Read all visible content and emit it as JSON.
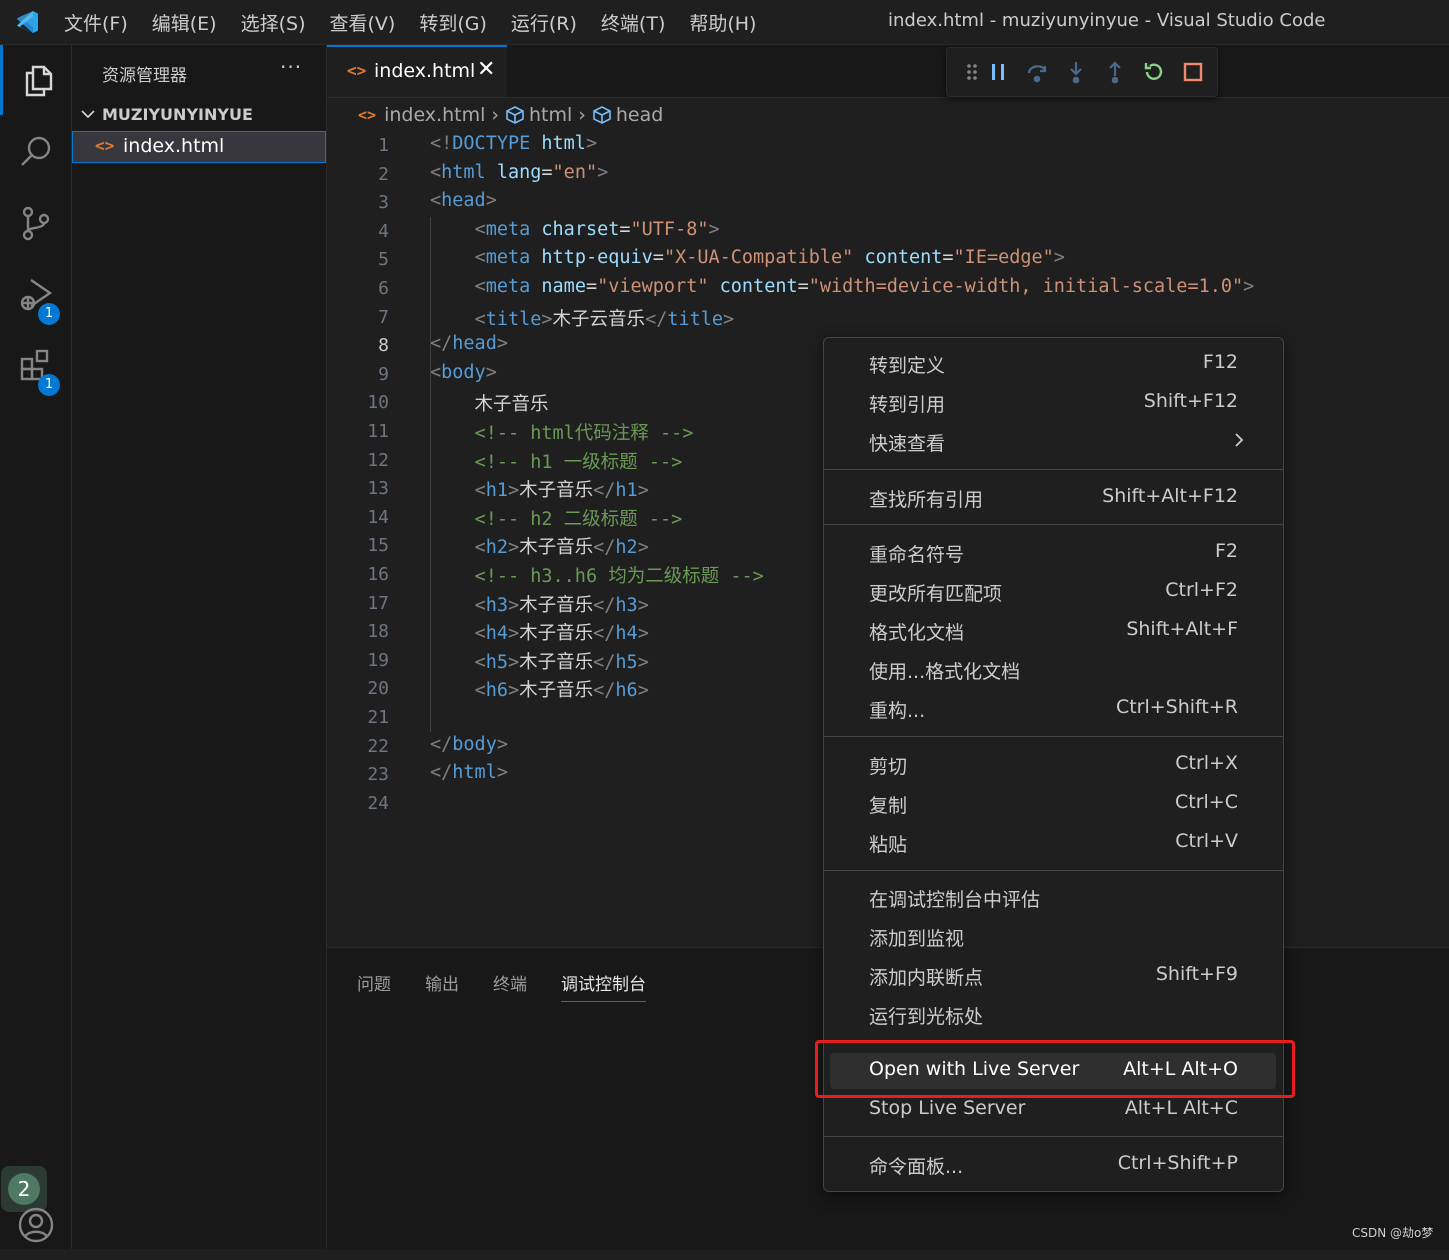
{
  "titlebar": {
    "menu": [
      "文件(F)",
      "编辑(E)",
      "选择(S)",
      "查看(V)",
      "转到(G)",
      "运行(R)",
      "终端(T)",
      "帮助(H)"
    ],
    "window_title": "index.html - muziyunyinyue - Visual Studio Code"
  },
  "activity_bar": {
    "items": [
      {
        "icon": "files-icon"
      },
      {
        "icon": "search-icon"
      },
      {
        "icon": "source-control-icon"
      },
      {
        "icon": "run-debug-icon",
        "badge": "1"
      },
      {
        "icon": "extensions-icon",
        "badge": "1"
      }
    ],
    "account_badge": "2"
  },
  "sidebar": {
    "title": "资源管理器",
    "more": "···",
    "folder": "MUZIYUNYINYUE",
    "files": [
      {
        "name": "index.html",
        "icon": "<>"
      }
    ]
  },
  "tabs": [
    {
      "label": "index.html",
      "icon": "<>",
      "close": "✕"
    }
  ],
  "breadcrumb": {
    "file": "index.html",
    "items": [
      "html",
      "head"
    ]
  },
  "editor": {
    "line_numbers": [
      "1",
      "2",
      "3",
      "4",
      "5",
      "6",
      "7",
      "8",
      "9",
      "10",
      "11",
      "12",
      "13",
      "14",
      "15",
      "16",
      "17",
      "18",
      "19",
      "20",
      "21",
      "22",
      "23",
      "24"
    ],
    "active_line": "8",
    "lines": [
      [
        [
          "c-punc",
          "<!"
        ],
        [
          "c-tag",
          "DOCTYPE"
        ],
        [
          "c-txt",
          " "
        ],
        [
          "c-attr",
          "html"
        ],
        [
          "c-punc",
          ">"
        ]
      ],
      [
        [
          "c-punc",
          "<"
        ],
        [
          "c-tag",
          "html"
        ],
        [
          "c-txt",
          " "
        ],
        [
          "c-attr",
          "lang"
        ],
        [
          "c-txt",
          "="
        ],
        [
          "c-str",
          "\"en\""
        ],
        [
          "c-punc",
          ">"
        ]
      ],
      [
        [
          "c-punc",
          "<"
        ],
        [
          "c-tag",
          "head"
        ],
        [
          "c-punc",
          ">"
        ]
      ],
      [
        [
          "c-txt",
          "    "
        ],
        [
          "c-punc",
          "<"
        ],
        [
          "c-tag",
          "meta"
        ],
        [
          "c-txt",
          " "
        ],
        [
          "c-attr",
          "charset"
        ],
        [
          "c-txt",
          "="
        ],
        [
          "c-str",
          "\"UTF-8\""
        ],
        [
          "c-punc",
          ">"
        ]
      ],
      [
        [
          "c-txt",
          "    "
        ],
        [
          "c-punc",
          "<"
        ],
        [
          "c-tag",
          "meta"
        ],
        [
          "c-txt",
          " "
        ],
        [
          "c-attr",
          "http-equiv"
        ],
        [
          "c-txt",
          "="
        ],
        [
          "c-str",
          "\"X-UA-Compatible\""
        ],
        [
          "c-txt",
          " "
        ],
        [
          "c-attr",
          "content"
        ],
        [
          "c-txt",
          "="
        ],
        [
          "c-str",
          "\"IE=edge\""
        ],
        [
          "c-punc",
          ">"
        ]
      ],
      [
        [
          "c-txt",
          "    "
        ],
        [
          "c-punc",
          "<"
        ],
        [
          "c-tag",
          "meta"
        ],
        [
          "c-txt",
          " "
        ],
        [
          "c-attr",
          "name"
        ],
        [
          "c-txt",
          "="
        ],
        [
          "c-str",
          "\"viewport\""
        ],
        [
          "c-txt",
          " "
        ],
        [
          "c-attr",
          "content"
        ],
        [
          "c-txt",
          "="
        ],
        [
          "c-str",
          "\"width=device-width, initial-scale=1.0\""
        ],
        [
          "c-punc",
          ">"
        ]
      ],
      [
        [
          "c-txt",
          "    "
        ],
        [
          "c-punc",
          "<"
        ],
        [
          "c-tag",
          "title"
        ],
        [
          "c-punc",
          ">"
        ],
        [
          "c-txt",
          "木子云音乐"
        ],
        [
          "c-punc",
          "</"
        ],
        [
          "c-tag",
          "title"
        ],
        [
          "c-punc",
          ">"
        ]
      ],
      [
        [
          "c-punc",
          "</"
        ],
        [
          "c-tag",
          "head"
        ],
        [
          "c-punc",
          ">"
        ]
      ],
      [
        [
          "c-punc",
          "<"
        ],
        [
          "c-tag",
          "body"
        ],
        [
          "c-punc",
          ">"
        ]
      ],
      [
        [
          "c-txt",
          "    木子音乐"
        ]
      ],
      [
        [
          "c-txt",
          "    "
        ],
        [
          "c-com",
          "<!-- html代码注释 -->"
        ]
      ],
      [
        [
          "c-txt",
          "    "
        ],
        [
          "c-com",
          "<!-- h1 一级标题 -->"
        ]
      ],
      [
        [
          "c-txt",
          "    "
        ],
        [
          "c-punc",
          "<"
        ],
        [
          "c-tag",
          "h1"
        ],
        [
          "c-punc",
          ">"
        ],
        [
          "c-txt",
          "木子音乐"
        ],
        [
          "c-punc",
          "</"
        ],
        [
          "c-tag",
          "h1"
        ],
        [
          "c-punc",
          ">"
        ]
      ],
      [
        [
          "c-txt",
          "    "
        ],
        [
          "c-com",
          "<!-- h2 二级标题 -->"
        ]
      ],
      [
        [
          "c-txt",
          "    "
        ],
        [
          "c-punc",
          "<"
        ],
        [
          "c-tag",
          "h2"
        ],
        [
          "c-punc",
          ">"
        ],
        [
          "c-txt",
          "木子音乐"
        ],
        [
          "c-punc",
          "</"
        ],
        [
          "c-tag",
          "h2"
        ],
        [
          "c-punc",
          ">"
        ]
      ],
      [
        [
          "c-txt",
          "    "
        ],
        [
          "c-com",
          "<!-- h3..h6 均为二级标题 -->"
        ]
      ],
      [
        [
          "c-txt",
          "    "
        ],
        [
          "c-punc",
          "<"
        ],
        [
          "c-tag",
          "h3"
        ],
        [
          "c-punc",
          ">"
        ],
        [
          "c-txt",
          "木子音乐"
        ],
        [
          "c-punc",
          "</"
        ],
        [
          "c-tag",
          "h3"
        ],
        [
          "c-punc",
          ">"
        ]
      ],
      [
        [
          "c-txt",
          "    "
        ],
        [
          "c-punc",
          "<"
        ],
        [
          "c-tag",
          "h4"
        ],
        [
          "c-punc",
          ">"
        ],
        [
          "c-txt",
          "木子音乐"
        ],
        [
          "c-punc",
          "</"
        ],
        [
          "c-tag",
          "h4"
        ],
        [
          "c-punc",
          ">"
        ]
      ],
      [
        [
          "c-txt",
          "    "
        ],
        [
          "c-punc",
          "<"
        ],
        [
          "c-tag",
          "h5"
        ],
        [
          "c-punc",
          ">"
        ],
        [
          "c-txt",
          "木子音乐"
        ],
        [
          "c-punc",
          "</"
        ],
        [
          "c-tag",
          "h5"
        ],
        [
          "c-punc",
          ">"
        ]
      ],
      [
        [
          "c-txt",
          "    "
        ],
        [
          "c-punc",
          "<"
        ],
        [
          "c-tag",
          "h6"
        ],
        [
          "c-punc",
          ">"
        ],
        [
          "c-txt",
          "木子音乐"
        ],
        [
          "c-punc",
          "</"
        ],
        [
          "c-tag",
          "h6"
        ],
        [
          "c-punc",
          ">"
        ]
      ],
      [
        [
          "c-txt",
          ""
        ]
      ],
      [
        [
          "c-punc",
          "</"
        ],
        [
          "c-tag",
          "body"
        ],
        [
          "c-punc",
          ">"
        ]
      ],
      [
        [
          "c-punc",
          "</"
        ],
        [
          "c-tag",
          "html"
        ],
        [
          "c-punc",
          ">"
        ]
      ],
      [
        [
          "c-txt",
          ""
        ]
      ]
    ]
  },
  "panel": {
    "tabs": [
      "问题",
      "输出",
      "终端",
      "调试控制台"
    ],
    "active_tab": "调试控制台"
  },
  "context_menu": {
    "items": [
      {
        "label": "转到定义",
        "key": "F12"
      },
      {
        "label": "转到引用",
        "key": "Shift+F12"
      },
      {
        "label": "快速查看",
        "key": "",
        "submenu": true
      },
      {
        "label": "查找所有引用",
        "key": "Shift+Alt+F12"
      },
      {
        "label": "重命名符号",
        "key": "F2"
      },
      {
        "label": "更改所有匹配项",
        "key": "Ctrl+F2"
      },
      {
        "label": "格式化文档",
        "key": "Shift+Alt+F"
      },
      {
        "label": "使用...格式化文档",
        "key": ""
      },
      {
        "label": "重构...",
        "key": "Ctrl+Shift+R"
      },
      {
        "label": "剪切",
        "key": "Ctrl+X"
      },
      {
        "label": "复制",
        "key": "Ctrl+C"
      },
      {
        "label": "粘贴",
        "key": "Ctrl+V"
      },
      {
        "label": "在调试控制台中评估",
        "key": ""
      },
      {
        "label": "添加到监视",
        "key": ""
      },
      {
        "label": "添加内联断点",
        "key": "Shift+F9"
      },
      {
        "label": "运行到光标处",
        "key": ""
      },
      {
        "label": "Open with Live Server",
        "key": "Alt+L Alt+O",
        "highlighted": true
      },
      {
        "label": "Stop Live Server",
        "key": "Alt+L Alt+C"
      },
      {
        "label": "命令面板...",
        "key": "Ctrl+Shift+P"
      }
    ]
  },
  "colors": {
    "accent": "#0078d4",
    "highlight_box": "#e81e1e",
    "html_icon": "#e37933"
  },
  "watermark": "CSDN @劫o梦"
}
